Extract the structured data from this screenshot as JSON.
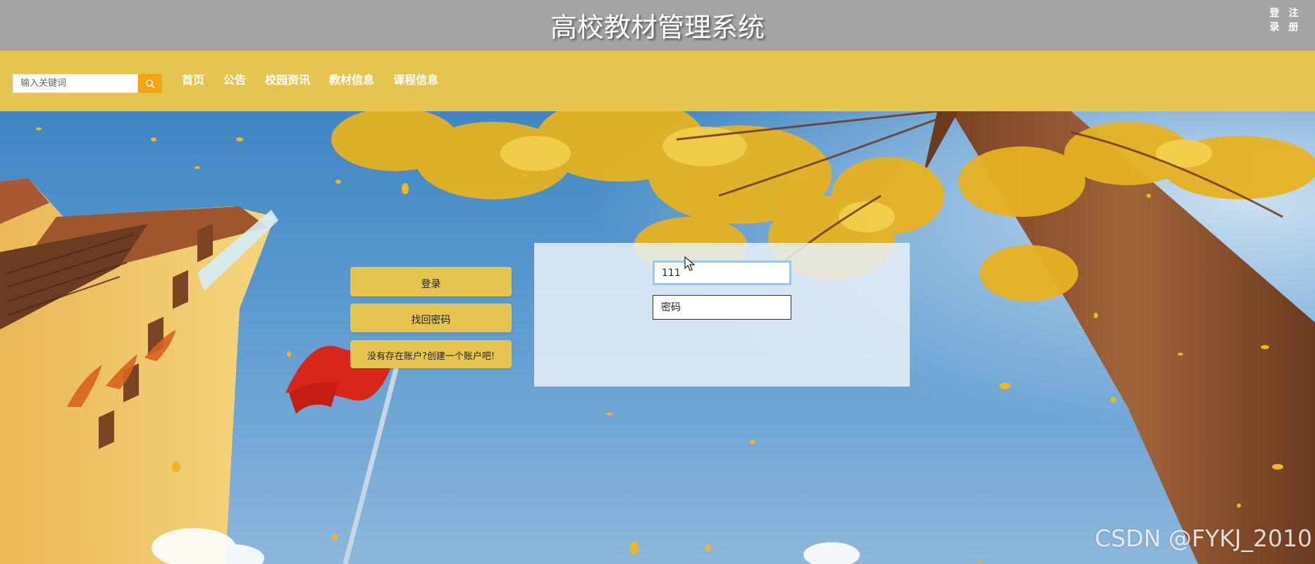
{
  "header": {
    "title": "高校教材管理系统",
    "auth_links": [
      {
        "label_top": "登",
        "label_bottom": "录",
        "name": "login"
      },
      {
        "label_top": "注",
        "label_bottom": "册",
        "name": "register"
      }
    ]
  },
  "nav": {
    "search_placeholder": "输入关键词",
    "search_icon": "search-icon",
    "items": [
      "首页",
      "公告",
      "校园资讯",
      "教材信息",
      "课程信息"
    ]
  },
  "side_buttons": {
    "login": "登录",
    "forgot_password": "找回密码",
    "create_account": "没有存在账户?创建一个账户吧!"
  },
  "login_form": {
    "username_value": "111",
    "password_placeholder": "密码"
  },
  "watermark": "CSDN @FYKJ_2010",
  "colors": {
    "topbar": "#a4a4a4",
    "navbar": "#e5c450",
    "search_button": "#f5a410",
    "sky": "#5d9bd0"
  }
}
